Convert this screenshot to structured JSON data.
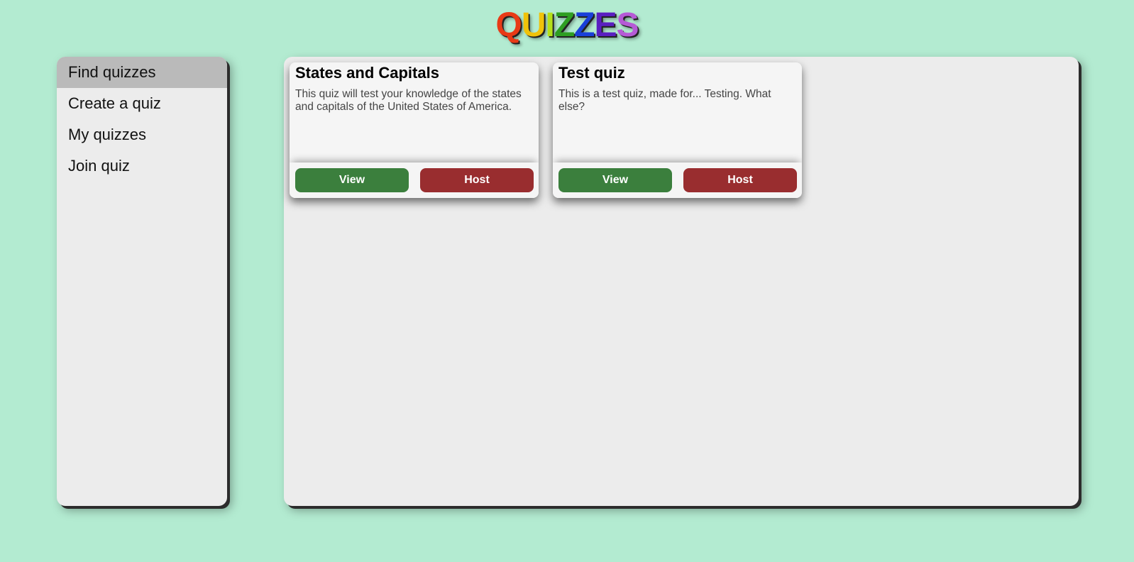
{
  "logo": {
    "letters": [
      "Q",
      "U",
      "I",
      "Z",
      "Z",
      "E",
      "S"
    ],
    "colors": [
      "#e83a16",
      "#f0c20a",
      "#b4e01a",
      "#2e9e22",
      "#1a3fd8",
      "#5a1fc0",
      "#b65ad6"
    ]
  },
  "sidebar": {
    "items": [
      {
        "label": "Find quizzes",
        "active": true
      },
      {
        "label": "Create a quiz",
        "active": false
      },
      {
        "label": "My quizzes",
        "active": false
      },
      {
        "label": "Join quiz",
        "active": false
      }
    ]
  },
  "quizzes": [
    {
      "title": "States and Capitals",
      "description": "This quiz will test your knowledge of the states and capitals of the United States of America.",
      "view_label": "View",
      "host_label": "Host"
    },
    {
      "title": "Test quiz",
      "description": "This is a test quiz, made for... Testing. What else?",
      "view_label": "View",
      "host_label": "Host"
    }
  ],
  "colors": {
    "background": "#b3ebd1",
    "panel": "#ececec",
    "active_nav": "#bababa",
    "view_button": "#3b7f3d",
    "host_button": "#992d2f"
  }
}
